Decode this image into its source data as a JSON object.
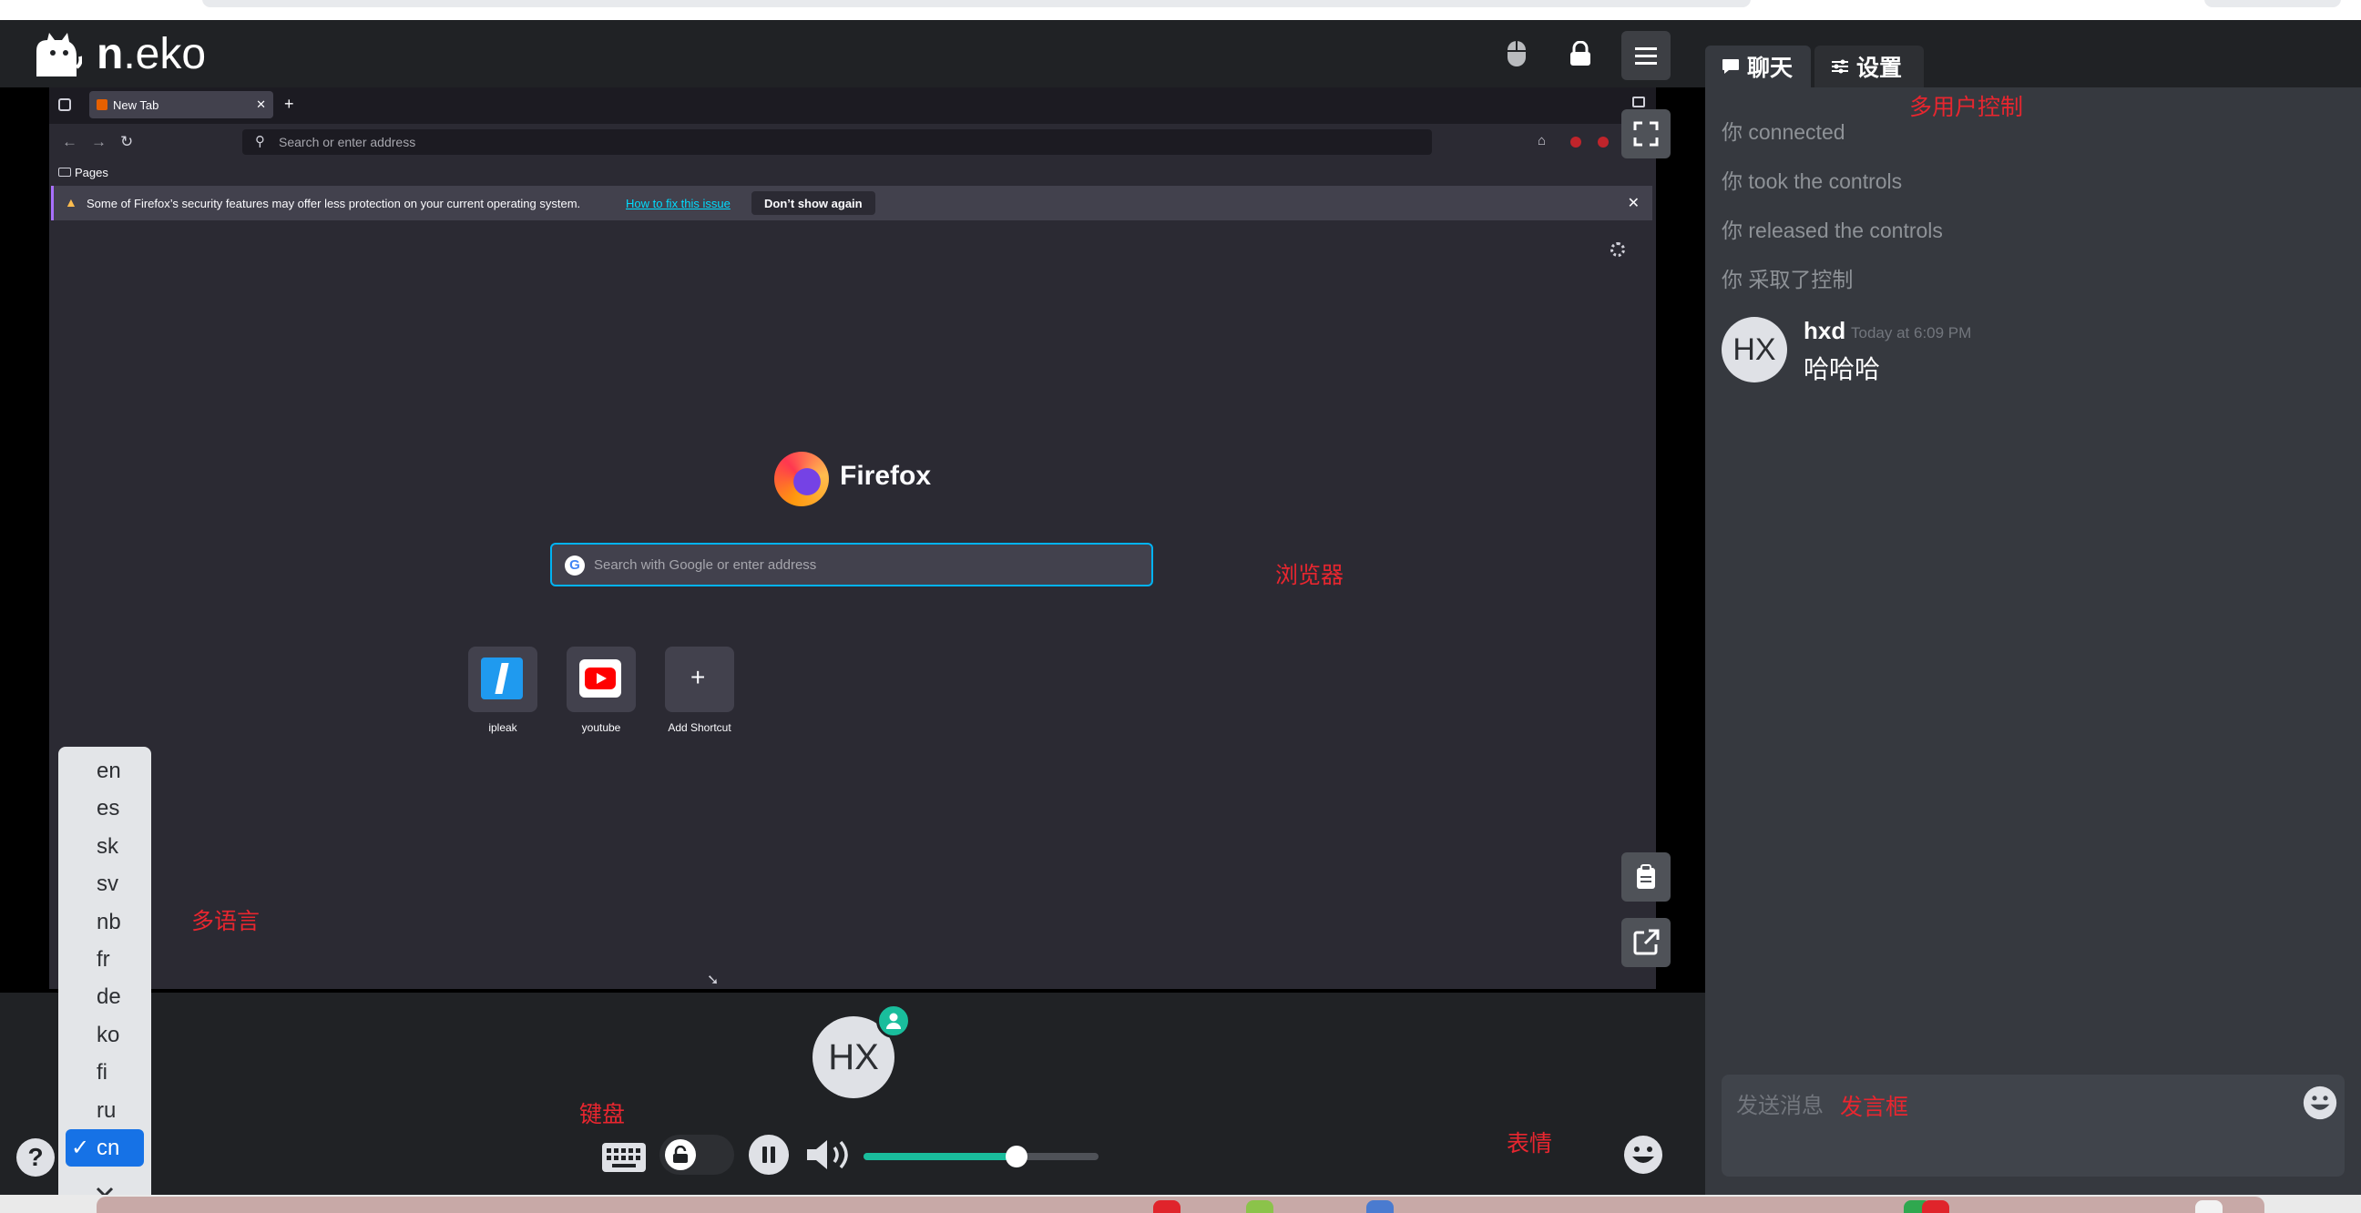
{
  "app": {
    "logo_bold": "n",
    "logo_rest": ".eko"
  },
  "browser": {
    "tab_title": "New Tab",
    "url_placeholder": "Search or enter address",
    "bookmark_folder": "Pages",
    "notice_message": "Some of Firefox’s security features may offer less protection on your current operating system.",
    "notice_link": "How to fix this issue",
    "notice_button": "Don’t show again",
    "brand": "Firefox",
    "search_placeholder": "Search with Google or enter address",
    "shortcuts": [
      {
        "label": "ipleak",
        "icon": "ipleak-icon"
      },
      {
        "label": "youtube",
        "icon": "youtube-icon"
      },
      {
        "label": "Add Shortcut",
        "icon": "plus-icon"
      }
    ]
  },
  "controls": {
    "member_initials": "HX",
    "volume_level": 0.65
  },
  "languages": {
    "options": [
      "en",
      "es",
      "sk",
      "sv",
      "nb",
      "fr",
      "de",
      "ko",
      "fi",
      "ru",
      "cn"
    ],
    "selected": "cn",
    "check": "✓"
  },
  "sidebar": {
    "tab_chat": "聊天",
    "tab_settings": "设置",
    "system_messages": [
      {
        "who": "你",
        "text": "connected"
      },
      {
        "who": "你",
        "text": "took the controls"
      },
      {
        "who": "你",
        "text": "released the controls"
      },
      {
        "who": "你",
        "text": "采取了控制"
      }
    ],
    "message": {
      "initials": "HX",
      "user": "hxd",
      "time": "Today at 6:09 PM",
      "text": "哈哈哈"
    },
    "input_placeholder": "发送消息"
  },
  "annotations": {
    "multi_user": "多用户控制",
    "browser": "浏览器",
    "multi_language": "多语言",
    "keyboard": "键盘",
    "emoji": "表情",
    "message_box": "发言框"
  },
  "colors": {
    "accent": "#19bd9c",
    "selection": "#1672e6",
    "annotation": "#e8262f"
  }
}
